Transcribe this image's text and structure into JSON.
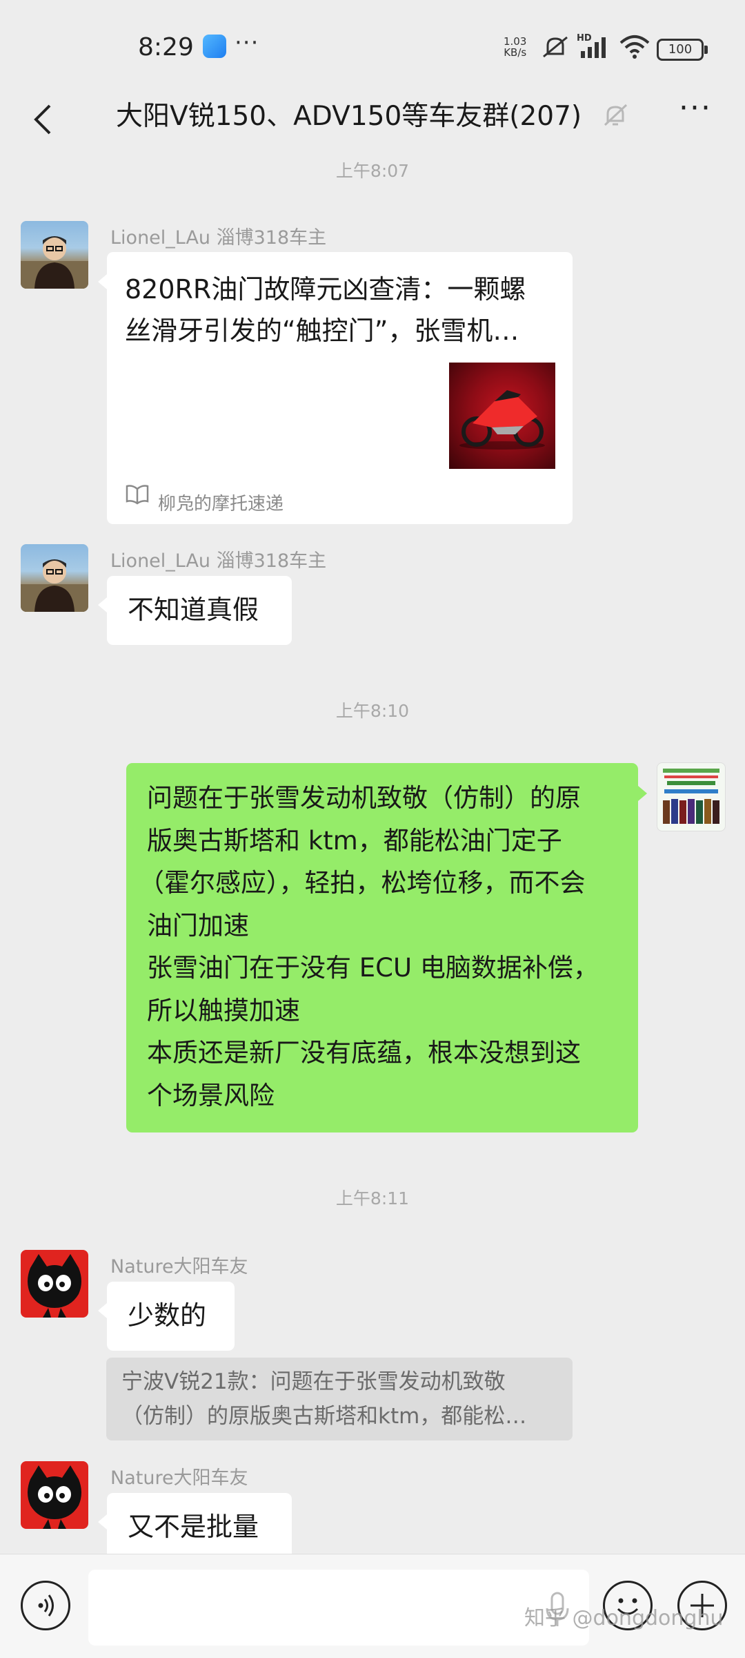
{
  "status_bar": {
    "time": "8:29",
    "more": "···",
    "net_speed_value": "1.03",
    "net_speed_unit": "KB/s",
    "signal_label": "HD",
    "battery": "100"
  },
  "nav": {
    "title": "大阳V锐150、ADV150等车友群(207)",
    "more": "···"
  },
  "messages": {
    "ts1": "上午8:07",
    "m1": {
      "sender": "Lionel_LAu 淄博318车主",
      "article_title_1": "820RR油门故障元凶查清：一颗螺",
      "article_title_2": "丝滑牙引发的“触控门”，张雪机…",
      "article_source": "柳凫的摩托速递"
    },
    "m2": {
      "sender": "Lionel_LAu 淄博318车主",
      "text": "不知道真假"
    },
    "ts2": "上午8:10",
    "m3": {
      "lines": [
        "问题在于张雪发动机致敬（仿制）的原",
        "版奥古斯塔和 ktm，都能松油门定子",
        "（霍尔感应），轻拍，松垮位移，而不会",
        "油门加速",
        "张雪油门在于没有 ECU 电脑数据补偿，",
        "所以触摸加速",
        "本质还是新厂没有底蕴，根本没想到这",
        "个场景风险"
      ]
    },
    "ts3": "上午8:11",
    "m4": {
      "sender": "Nature大阳车友",
      "text": "少数的",
      "quote_1": "宁波V锐21款：问题在于张雪发动机致敬",
      "quote_2": "（仿制）的原版奥古斯塔和ktm，都能松…"
    },
    "m5": {
      "sender": "Nature大阳车友",
      "text": "又不是批量"
    }
  },
  "input_bar": {
    "placeholder": ""
  },
  "watermark": "知乎 @dongdonghu",
  "colors": {
    "background": "#ededed",
    "self_bubble": "#95ec69",
    "other_bubble": "#ffffff",
    "timestamp": "#a8a8a8"
  },
  "icons": [
    "app-notification-icon",
    "mute-icon",
    "signal-icon",
    "wifi-icon",
    "battery-icon",
    "back-icon",
    "bell-muted-icon",
    "more-icon",
    "book-icon",
    "voice-icon",
    "mic-icon",
    "emoji-icon",
    "plus-icon"
  ]
}
